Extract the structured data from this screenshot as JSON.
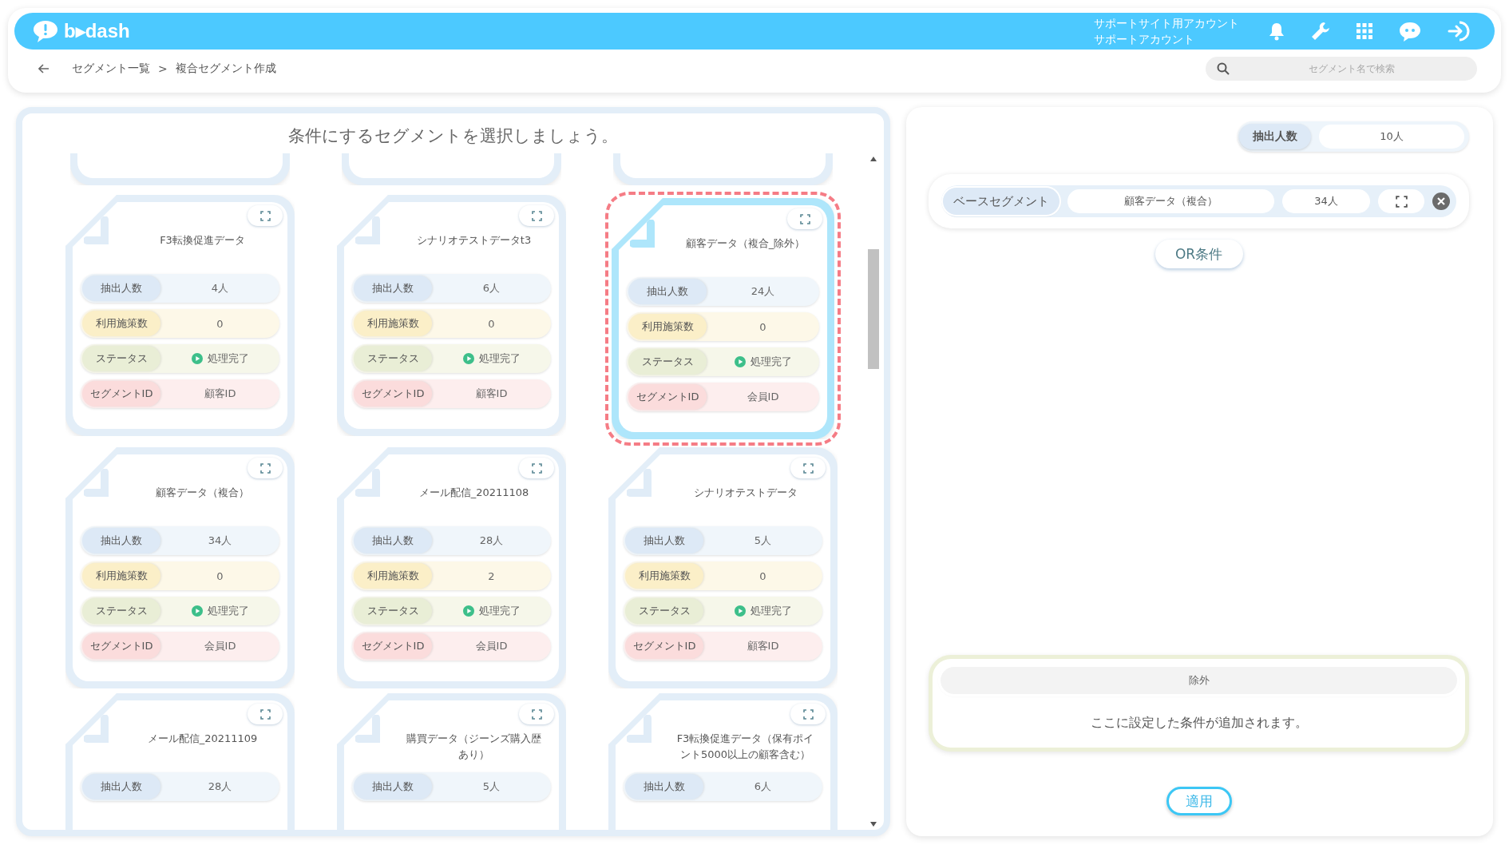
{
  "header": {
    "logo": "b▸dash",
    "account_lines": [
      "サポートサイト用アカウント",
      "サポートアカウント"
    ]
  },
  "breadcrumb": {
    "items": [
      "セグメント一覧",
      "複合セグメント作成"
    ],
    "separator": ">"
  },
  "search": {
    "placeholder": "セグメント名で検索"
  },
  "picker": {
    "title": "条件にするセグメントを選択しましょう。",
    "cards": [
      {
        "name": "F3転換促進データ",
        "selected": false,
        "rows": [
          {
            "kind": "count",
            "label": "抽出人数",
            "value": "4人"
          },
          {
            "kind": "usage",
            "label": "利用施策数",
            "value": "0"
          },
          {
            "kind": "status",
            "label": "ステータス",
            "value": "処理完了"
          },
          {
            "kind": "id",
            "label": "セグメントID",
            "value": "顧客ID"
          }
        ]
      },
      {
        "name": "シナリオテストデータt3",
        "selected": false,
        "rows": [
          {
            "kind": "count",
            "label": "抽出人数",
            "value": "6人"
          },
          {
            "kind": "usage",
            "label": "利用施策数",
            "value": "0"
          },
          {
            "kind": "status",
            "label": "ステータス",
            "value": "処理完了"
          },
          {
            "kind": "id",
            "label": "セグメントID",
            "value": "顧客ID"
          }
        ]
      },
      {
        "name": "顧客データ（複合_除外）",
        "selected": true,
        "rows": [
          {
            "kind": "count",
            "label": "抽出人数",
            "value": "24人"
          },
          {
            "kind": "usage",
            "label": "利用施策数",
            "value": "0"
          },
          {
            "kind": "status",
            "label": "ステータス",
            "value": "処理完了"
          },
          {
            "kind": "id",
            "label": "セグメントID",
            "value": "会員ID"
          }
        ]
      },
      {
        "name": "顧客データ（複合）",
        "selected": false,
        "rows": [
          {
            "kind": "count",
            "label": "抽出人数",
            "value": "34人"
          },
          {
            "kind": "usage",
            "label": "利用施策数",
            "value": "0"
          },
          {
            "kind": "status",
            "label": "ステータス",
            "value": "処理完了"
          },
          {
            "kind": "id",
            "label": "セグメントID",
            "value": "会員ID"
          }
        ]
      },
      {
        "name": "メール配信_20211108",
        "selected": false,
        "rows": [
          {
            "kind": "count",
            "label": "抽出人数",
            "value": "28人"
          },
          {
            "kind": "usage",
            "label": "利用施策数",
            "value": "2"
          },
          {
            "kind": "status",
            "label": "ステータス",
            "value": "処理完了"
          },
          {
            "kind": "id",
            "label": "セグメントID",
            "value": "会員ID"
          }
        ]
      },
      {
        "name": "シナリオテストデータ",
        "selected": false,
        "rows": [
          {
            "kind": "count",
            "label": "抽出人数",
            "value": "5人"
          },
          {
            "kind": "usage",
            "label": "利用施策数",
            "value": "0"
          },
          {
            "kind": "status",
            "label": "ステータス",
            "value": "処理完了"
          },
          {
            "kind": "id",
            "label": "セグメントID",
            "value": "顧客ID"
          }
        ]
      },
      {
        "name": "メール配信_20211109",
        "selected": false,
        "rows": [
          {
            "kind": "count",
            "label": "抽出人数",
            "value": "28人"
          }
        ]
      },
      {
        "name": "購買データ（ジーンズ購入歴あり）",
        "selected": false,
        "rows": [
          {
            "kind": "count",
            "label": "抽出人数",
            "value": "5人"
          }
        ]
      },
      {
        "name": "F3転換促進データ（保有ポイント5000以上の顧客含む）",
        "selected": false,
        "rows": [
          {
            "kind": "count",
            "label": "抽出人数",
            "value": "6人"
          }
        ]
      }
    ]
  },
  "result": {
    "count_label": "抽出人数",
    "count_value": "10人",
    "base": {
      "label": "ベースセグメント",
      "name": "顧客データ（複合）",
      "count": "34人"
    },
    "or_button": "OR条件",
    "exclude": {
      "label": "除外",
      "message": "ここに設定した条件が追加されます。"
    },
    "apply_button": "適用"
  }
}
